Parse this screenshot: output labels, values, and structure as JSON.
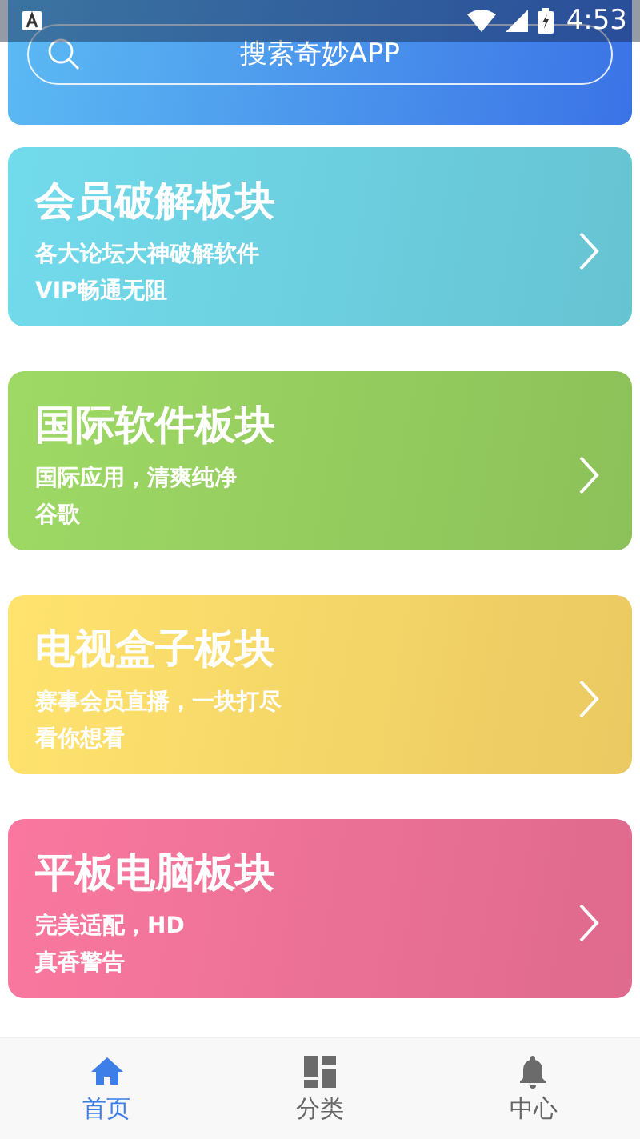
{
  "status_bar": {
    "time": "4:53"
  },
  "search": {
    "placeholder": "搜索奇妙APP"
  },
  "cards": [
    {
      "title": "会员破解板块",
      "lines": [
        "各大论坛大神破解软件",
        "VIP畅通无阻"
      ],
      "color": "#6ccfdf"
    },
    {
      "title": "国际软件板块",
      "lines": [
        "国际应用，清爽纯净",
        "谷歌"
      ],
      "color": "#95cd5f"
    },
    {
      "title": "电视盒子板块",
      "lines": [
        "赛事会员直播，一块打尽",
        "看你想看"
      ],
      "color": "#f9d668"
    },
    {
      "title": "平板电脑板块",
      "lines": [
        "完美适配，HD",
        "真香警告"
      ],
      "color": "#ec7196"
    }
  ],
  "tabs": [
    {
      "label": "首页",
      "selected": true
    },
    {
      "label": "分类",
      "selected": false
    },
    {
      "label": "中心",
      "selected": false
    }
  ]
}
